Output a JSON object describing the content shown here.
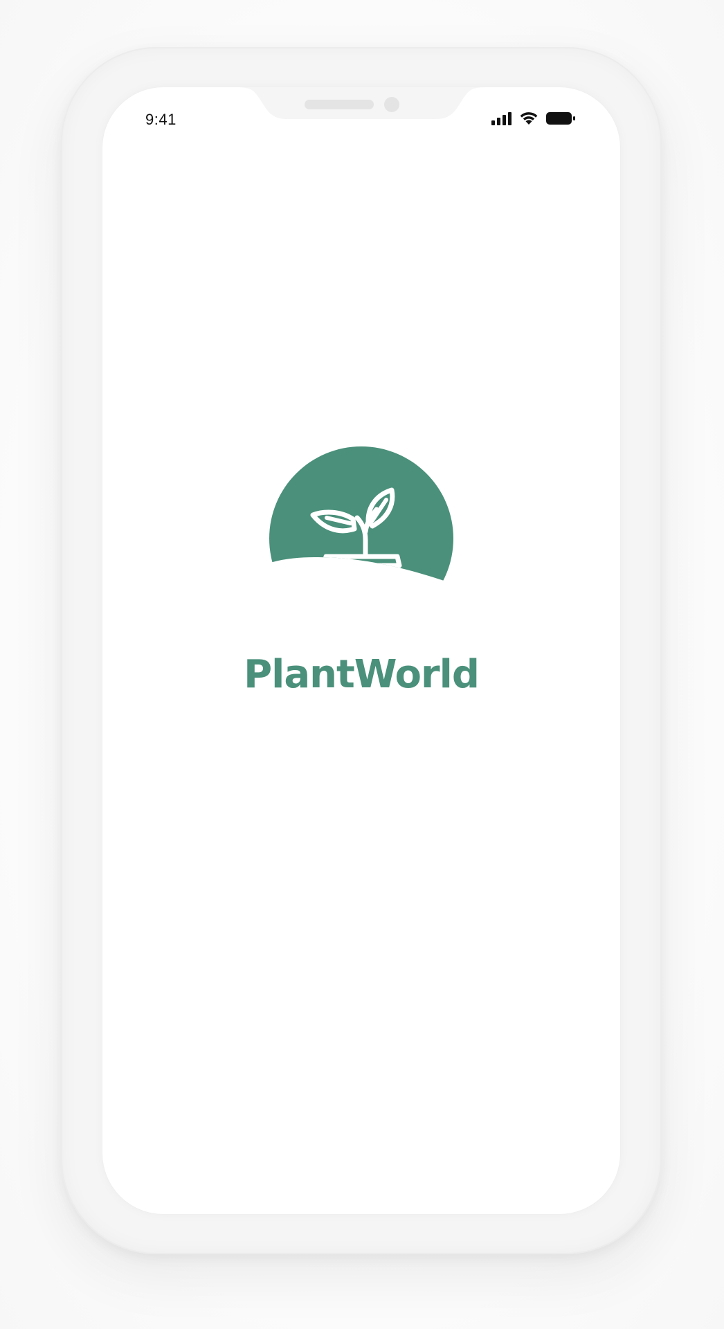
{
  "status_bar": {
    "time": "9:41",
    "icons": [
      "cellular-signal-icon",
      "wifi-icon",
      "battery-icon"
    ]
  },
  "splash": {
    "logo_icon": "sprout-in-pot-icon",
    "app_name": "PlantWorld"
  },
  "colors": {
    "brand_green": "#4a907a",
    "screen_background": "#ffffff",
    "frame": "#f5f5f5"
  }
}
